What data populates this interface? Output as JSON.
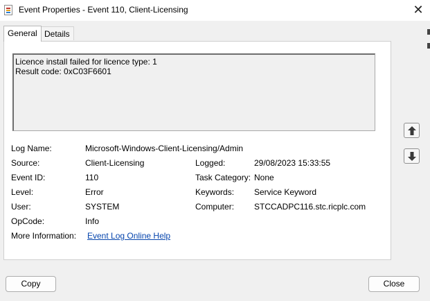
{
  "window": {
    "title": "Event Properties - Event 110, Client-Licensing",
    "close_glyph": "✕"
  },
  "tabs": [
    {
      "label": "General",
      "active": true
    },
    {
      "label": "Details",
      "active": false
    }
  ],
  "description": {
    "lines": [
      "Licence install failed for licence type: 1",
      "Result code: 0xC03F6601"
    ]
  },
  "fields": {
    "log_name": {
      "label": "Log Name:",
      "value": "Microsoft-Windows-Client-Licensing/Admin"
    },
    "source": {
      "label": "Source:",
      "value": "Client-Licensing"
    },
    "logged": {
      "label": "Logged:",
      "value": "29/08/2023 15:33:55"
    },
    "event_id": {
      "label": "Event ID:",
      "value": "110"
    },
    "task_category": {
      "label": "Task Category:",
      "value": "None"
    },
    "level": {
      "label": "Level:",
      "value": "Error"
    },
    "keywords": {
      "label": "Keywords:",
      "value": "Service Keyword"
    },
    "user": {
      "label": "User:",
      "value": "SYSTEM"
    },
    "computer": {
      "label": "Computer:",
      "value": "STCCADPC116.stc.ricplc.com"
    },
    "opcode": {
      "label": "OpCode:",
      "value": "Info"
    },
    "more_info": {
      "label": "More Information:",
      "value": "Event Log Online Help"
    }
  },
  "navigation": {
    "up_icon": "arrow-up-icon",
    "down_icon": "arrow-down-icon"
  },
  "buttons": {
    "copy": "Copy",
    "close": "Close"
  },
  "colors": {
    "link": "#0645ad",
    "background": "#f0f0f0"
  }
}
